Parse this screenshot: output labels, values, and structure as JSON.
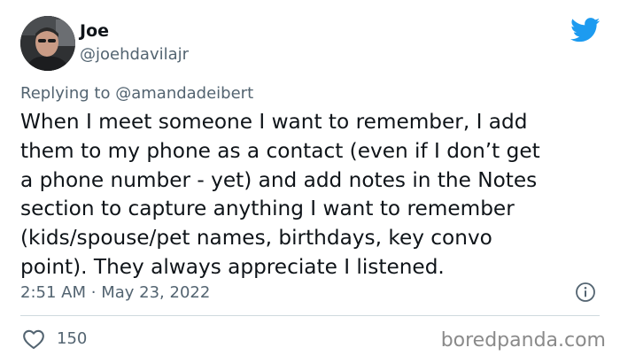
{
  "author": {
    "name": "Joe",
    "handle": "@joehdavilajr"
  },
  "reply": {
    "prefix": "Replying to",
    "mention": "@amandadeibert"
  },
  "tweet": {
    "lines": [
      "When I meet someone I want to remember, I add",
      "them to my phone as a contact (even if I don’t get",
      "a phone number - yet) and add notes in the Notes",
      "section to capture anything I want to remember",
      "(kids/spouse/pet names, birthdays, key convo",
      "point). They always appreciate I listened."
    ]
  },
  "timestamp": {
    "time": "2:51 AM",
    "separator": "·",
    "date": "May 23, 2022"
  },
  "actions": {
    "like_count": "150"
  },
  "watermark": "boredpanda.com",
  "icons": {
    "brand": "twitter-bird-icon",
    "info": "info-icon",
    "like": "heart-icon"
  },
  "colors": {
    "brand": "#1d9bf0",
    "text": "#0f1419",
    "secondary": "#536471",
    "divider": "#cfd9de",
    "watermark": "#8a8a8a"
  }
}
